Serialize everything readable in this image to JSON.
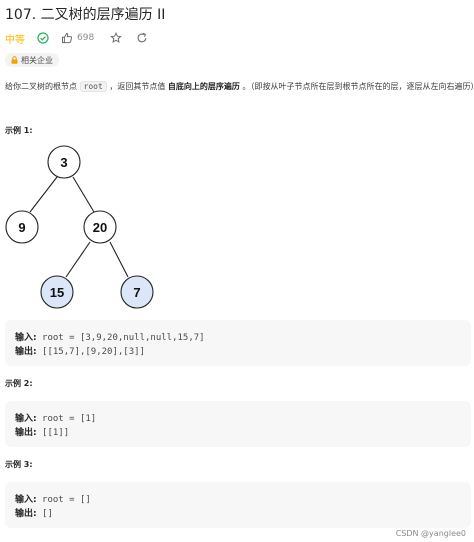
{
  "problem": {
    "title": "107. 二叉树的层序遍历 II",
    "difficulty": "中等",
    "likes": "698",
    "company_tag": "相关企业",
    "description": {
      "part1": "给你二叉树的根节点",
      "code": "root",
      "part2": "，返回其节点值",
      "bold": "自底向上的层序遍历",
      "part3": "。（即按从叶子节点所在层到根节点所在的层，逐层从左向右遍历）"
    }
  },
  "examples": [
    {
      "title": "示例 1:",
      "input_label": "输入:",
      "input": "root = [3,9,20,null,null,15,7]",
      "output_label": "输出:",
      "output": "[[15,7],[9,20],[3]]"
    },
    {
      "title": "示例 2:",
      "input_label": "输入:",
      "input": "root = [1]",
      "output_label": "输出:",
      "output": "[[1]]"
    },
    {
      "title": "示例 3:",
      "input_label": "输入:",
      "input": "root = []",
      "output_label": "输出:",
      "output": "[]"
    }
  ],
  "tree": {
    "nodes": [
      {
        "label": "3",
        "highlight": false
      },
      {
        "label": "9",
        "highlight": false
      },
      {
        "label": "20",
        "highlight": false
      },
      {
        "label": "15",
        "highlight": true
      },
      {
        "label": "7",
        "highlight": true
      }
    ]
  },
  "watermark": "CSDN @yanglee0",
  "colors": {
    "difficulty": "#ffb800",
    "check": "#2db55d",
    "highlight_node": "#dbe7f8"
  },
  "icons": [
    "check-circle-icon",
    "thumbs-up-icon",
    "star-icon",
    "share-icon",
    "lock-icon"
  ]
}
